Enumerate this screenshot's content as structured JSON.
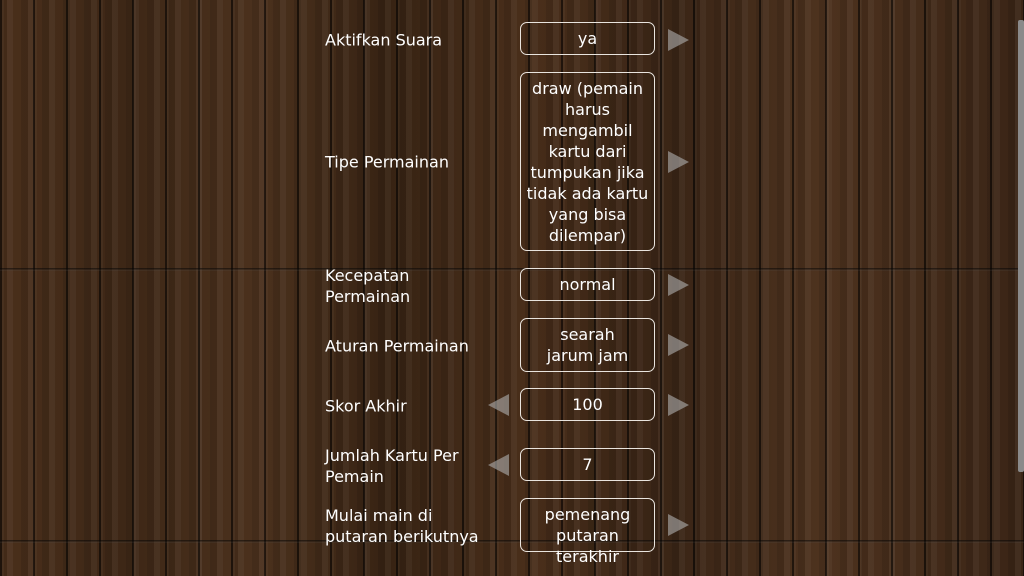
{
  "settings": [
    {
      "id": "aktifkan-suara",
      "label": "Aktifkan Suara",
      "value": "ya",
      "has_prev": false,
      "has_next": true
    },
    {
      "id": "tipe-permainan",
      "label": "Tipe Permainan",
      "value": "draw (pemain harus mengambil kartu dari tumpukan jika tidak ada kartu yang bisa dilempar)",
      "has_prev": false,
      "has_next": true
    },
    {
      "id": "kecepatan-permainan",
      "label": "Kecepatan Permainan",
      "value": "normal",
      "has_prev": false,
      "has_next": true
    },
    {
      "id": "aturan-permainan",
      "label": "Aturan Permainan",
      "value": "searah jarum jam",
      "has_prev": false,
      "has_next": true
    },
    {
      "id": "skor-akhir",
      "label": "Skor Akhir",
      "value": "100",
      "has_prev": true,
      "has_next": true
    },
    {
      "id": "jumlah-kartu",
      "label": "Jumlah Kartu Per Pemain",
      "value": "7",
      "has_prev": true,
      "has_next": false
    },
    {
      "id": "mulai-main",
      "label": "Mulai main di putaran berikutnya",
      "value": "pemenang putaran terakhir",
      "has_prev": false,
      "has_next": true
    }
  ],
  "icons": {
    "prev": "arrow-left-icon",
    "next": "arrow-right-icon"
  },
  "colors": {
    "text": "#ffffff",
    "box_border": "#e9e4de",
    "arrow": "#afafaf",
    "wood": "#3b2616"
  }
}
